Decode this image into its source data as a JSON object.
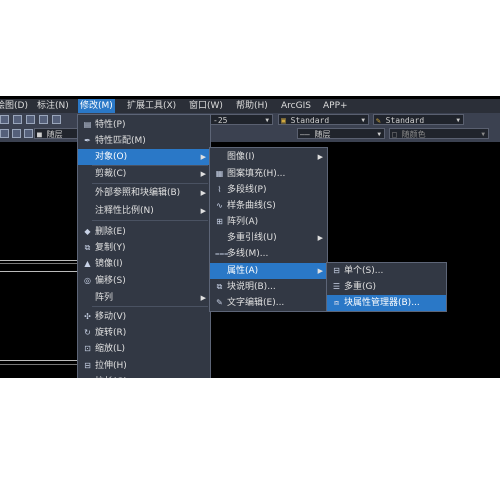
{
  "menubar": {
    "items": [
      "绘图(D)",
      "标注(N)",
      "修改(M)",
      "扩展工具(X)",
      "窗口(W)",
      "帮助(H)",
      "ArcGIS",
      "APP+"
    ],
    "active": "修改(M)"
  },
  "toolbar": {
    "scale_value": "-25",
    "textstyle_value": "Standard",
    "dimstyle_value": "Standard",
    "layer_left": "随层",
    "linetype": "—— 随层",
    "color": "随颜色"
  },
  "modify_menu": {
    "items": [
      {
        "label": "特性(P)",
        "icon": "properties-icon",
        "glyph": "▤"
      },
      {
        "label": "特性匹配(M)",
        "icon": "match-properties-icon",
        "glyph": "✒"
      },
      {
        "label": "对象(O)",
        "submenu": true
      },
      {
        "label": "剪裁(C)",
        "submenu": true
      },
      {
        "label": "外部参照和块编辑(B)",
        "submenu": true
      },
      {
        "label": "注释性比例(N)",
        "submenu": true
      },
      {
        "label": "删除(E)",
        "icon": "erase-icon",
        "glyph": "◆"
      },
      {
        "label": "复制(Y)",
        "icon": "copy-icon",
        "glyph": "⧉"
      },
      {
        "label": "镜像(I)",
        "icon": "mirror-icon",
        "glyph": "▲"
      },
      {
        "label": "偏移(S)",
        "icon": "offset-icon",
        "glyph": "◎"
      },
      {
        "label": "阵列",
        "submenu": true
      },
      {
        "label": "移动(V)",
        "icon": "move-icon",
        "glyph": "✣"
      },
      {
        "label": "旋转(R)",
        "icon": "rotate-icon",
        "glyph": "↻"
      },
      {
        "label": "缩放(L)",
        "icon": "scale-icon",
        "glyph": "⊡"
      },
      {
        "label": "拉伸(H)",
        "icon": "stretch-icon",
        "glyph": "⊟"
      },
      {
        "label": "拉长(G)",
        "icon": "lengthen-icon",
        "glyph": "↗"
      }
    ]
  },
  "object_menu": {
    "items": [
      {
        "label": "图像(I)",
        "submenu": true
      },
      {
        "label": "图案填充(H)...",
        "icon": "hatch-icon",
        "glyph": "▦"
      },
      {
        "label": "多段线(P)",
        "icon": "polyline-icon",
        "glyph": "⌇"
      },
      {
        "label": "样条曲线(S)",
        "icon": "spline-icon",
        "glyph": "∿"
      },
      {
        "label": "阵列(A)",
        "icon": "array-icon",
        "glyph": "⊞"
      },
      {
        "label": "多重引线(U)",
        "submenu": true
      },
      {
        "label": "多线(M)...",
        "icon": "multiline-icon",
        "glyph": "⩶"
      },
      {
        "label": "属性(A)",
        "submenu": true
      },
      {
        "label": "块说明(B)...",
        "icon": "block-description-icon",
        "glyph": "⧉"
      },
      {
        "label": "文字编辑(E)...",
        "icon": "text-edit-icon",
        "glyph": "✎"
      }
    ]
  },
  "attribute_menu": {
    "items": [
      {
        "label": "单个(S)...",
        "icon": "single-attribute-icon",
        "glyph": "⊟"
      },
      {
        "label": "多重(G)",
        "icon": "multiple-attribute-icon",
        "glyph": "☰"
      },
      {
        "label": "块属性管理器(B)...",
        "icon": "block-attribute-manager-icon",
        "glyph": "⧈"
      }
    ]
  }
}
